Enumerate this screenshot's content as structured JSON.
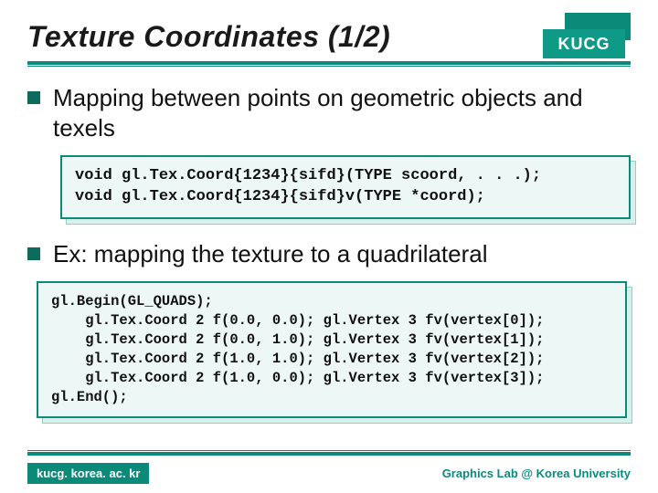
{
  "header": {
    "title": "Texture Coordinates (1/2)",
    "badge": "KUCG"
  },
  "bullets": [
    {
      "text": "Mapping between points on geometric objects and texels"
    },
    {
      "text": "Ex: mapping the texture to a quadrilateral"
    }
  ],
  "code1": "void gl.Tex.Coord{1234}{sifd}(TYPE scoord, . . .);\nvoid gl.Tex.Coord{1234}{sifd}v(TYPE *coord);",
  "code2": "gl.Begin(GL_QUADS);\n    gl.Tex.Coord 2 f(0.0, 0.0); gl.Vertex 3 fv(vertex[0]);\n    gl.Tex.Coord 2 f(0.0, 1.0); gl.Vertex 3 fv(vertex[1]);\n    gl.Tex.Coord 2 f(1.0, 1.0); gl.Vertex 3 fv(vertex[2]);\n    gl.Tex.Coord 2 f(1.0, 0.0); gl.Vertex 3 fv(vertex[3]);\ngl.End();",
  "footer": {
    "left": "kucg. korea. ac. kr",
    "right": "Graphics Lab @ Korea University"
  },
  "colors": {
    "accent": "#0b8a7a",
    "accentLight": "#edf8f6"
  }
}
